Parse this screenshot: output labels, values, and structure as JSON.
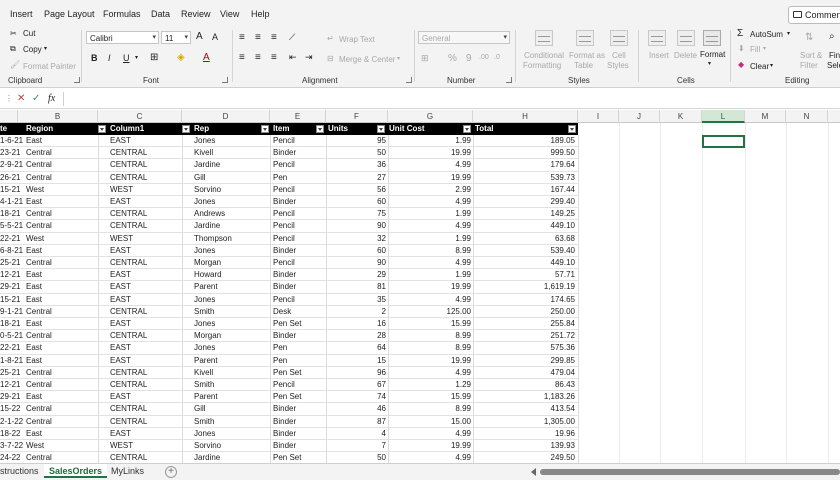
{
  "menu": [
    "Insert",
    "Page Layout",
    "Formulas",
    "Data",
    "Review",
    "View",
    "Help"
  ],
  "comments_label": "Comment",
  "ribbon": {
    "clipboard": {
      "cut": "Cut",
      "copy": "Copy",
      "format_painter": "Format Painter",
      "label": "Clipboard"
    },
    "font": {
      "name": "Calibri",
      "size": "11",
      "label": "Font"
    },
    "alignment": {
      "wrap": "Wrap Text",
      "merge": "Merge & Center",
      "label": "Alignment"
    },
    "number": {
      "format": "General",
      "label": "Number"
    },
    "styles": {
      "conditional_1": "Conditional",
      "conditional_2": "Formatting",
      "format_table_1": "Format as",
      "format_table_2": "Table",
      "cell_styles_1": "Cell",
      "cell_styles_2": "Styles",
      "label": "Styles"
    },
    "cells": {
      "insert": "Insert",
      "delete": "Delete",
      "format": "Format",
      "label": "Cells"
    },
    "editing": {
      "autosum": "AutoSum",
      "fill": "Fill",
      "clear": "Clear",
      "sort_1": "Sort &",
      "sort_2": "Filter",
      "find_1": "Find",
      "find_2": "Sele",
      "label": "Editing"
    }
  },
  "formula_bar": {
    "fx": "fx",
    "value": ""
  },
  "columns": [
    "B",
    "C",
    "D",
    "E",
    "F",
    "G",
    "H",
    "I",
    "J",
    "K",
    "L",
    "M",
    "N"
  ],
  "selected_column": "L",
  "table": {
    "headers": [
      "te",
      "Region",
      "Column1",
      "Rep",
      "Item",
      "Units",
      "Unit Cost",
      "Total"
    ],
    "rows": [
      [
        "1-6-21",
        "East",
        "EAST",
        "Jones",
        "Pencil",
        "95",
        "1.99",
        "189.05"
      ],
      [
        "23-21",
        "Central",
        "CENTRAL",
        "Kivell",
        "Binder",
        "50",
        "19.99",
        "999.50"
      ],
      [
        "2-9-21",
        "Central",
        "CENTRAL",
        "Jardine",
        "Pencil",
        "36",
        "4.99",
        "179.64"
      ],
      [
        "26-21",
        "Central",
        "CENTRAL",
        "Gill",
        "Pen",
        "27",
        "19.99",
        "539.73"
      ],
      [
        "15-21",
        "West",
        "WEST",
        "Sorvino",
        "Pencil",
        "56",
        "2.99",
        "167.44"
      ],
      [
        "4-1-21",
        "East",
        "EAST",
        "Jones",
        "Binder",
        "60",
        "4.99",
        "299.40"
      ],
      [
        "18-21",
        "Central",
        "CENTRAL",
        "Andrews",
        "Pencil",
        "75",
        "1.99",
        "149.25"
      ],
      [
        "5-5-21",
        "Central",
        "CENTRAL",
        "Jardine",
        "Pencil",
        "90",
        "4.99",
        "449.10"
      ],
      [
        "22-21",
        "West",
        "WEST",
        "Thompson",
        "Pencil",
        "32",
        "1.99",
        "63.68"
      ],
      [
        "6-8-21",
        "East",
        "EAST",
        "Jones",
        "Binder",
        "60",
        "8.99",
        "539.40"
      ],
      [
        "25-21",
        "Central",
        "CENTRAL",
        "Morgan",
        "Pencil",
        "90",
        "4.99",
        "449.10"
      ],
      [
        "12-21",
        "East",
        "EAST",
        "Howard",
        "Binder",
        "29",
        "1.99",
        "57.71"
      ],
      [
        "29-21",
        "East",
        "EAST",
        "Parent",
        "Binder",
        "81",
        "19.99",
        "1,619.19"
      ],
      [
        "15-21",
        "East",
        "EAST",
        "Jones",
        "Pencil",
        "35",
        "4.99",
        "174.65"
      ],
      [
        "9-1-21",
        "Central",
        "CENTRAL",
        "Smith",
        "Desk",
        "2",
        "125.00",
        "250.00"
      ],
      [
        "18-21",
        "East",
        "EAST",
        "Jones",
        "Pen Set",
        "16",
        "15.99",
        "255.84"
      ],
      [
        "0-5-21",
        "Central",
        "CENTRAL",
        "Morgan",
        "Binder",
        "28",
        "8.99",
        "251.72"
      ],
      [
        "22-21",
        "East",
        "EAST",
        "Jones",
        "Pen",
        "64",
        "8.99",
        "575.36"
      ],
      [
        "1-8-21",
        "East",
        "EAST",
        "Parent",
        "Pen",
        "15",
        "19.99",
        "299.85"
      ],
      [
        "25-21",
        "Central",
        "CENTRAL",
        "Kivell",
        "Pen Set",
        "96",
        "4.99",
        "479.04"
      ],
      [
        "12-21",
        "Central",
        "CENTRAL",
        "Smith",
        "Pencil",
        "67",
        "1.29",
        "86.43"
      ],
      [
        "29-21",
        "East",
        "EAST",
        "Parent",
        "Pen Set",
        "74",
        "15.99",
        "1,183.26"
      ],
      [
        "15-22",
        "Central",
        "CENTRAL",
        "Gill",
        "Binder",
        "46",
        "8.99",
        "413.54"
      ],
      [
        "2-1-22",
        "Central",
        "CENTRAL",
        "Smith",
        "Binder",
        "87",
        "15.00",
        "1,305.00"
      ],
      [
        "18-22",
        "East",
        "EAST",
        "Jones",
        "Binder",
        "4",
        "4.99",
        "19.96"
      ],
      [
        "3-7-22",
        "West",
        "WEST",
        "Sorvino",
        "Binder",
        "7",
        "19.99",
        "139.93"
      ],
      [
        "24-22",
        "Central",
        "CENTRAL",
        "Jardine",
        "Pen Set",
        "50",
        "4.99",
        "249.50"
      ]
    ]
  },
  "sheet_tabs": [
    "structions",
    "SalesOrders",
    "MyLinks"
  ],
  "active_tab": "SalesOrders",
  "colors": {
    "accent_green": "#217346",
    "header_black": "#000000"
  }
}
